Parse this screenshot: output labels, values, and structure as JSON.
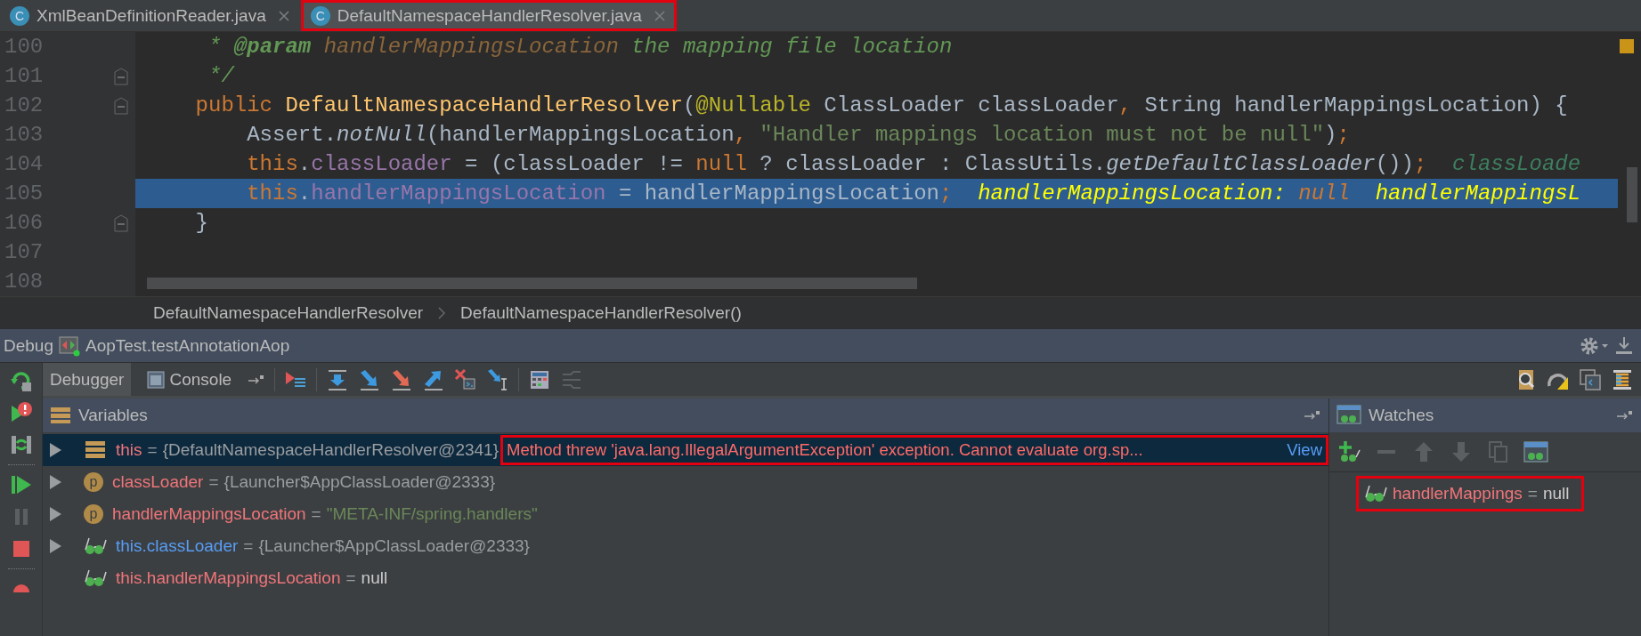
{
  "editor_tabs": [
    {
      "icon": "C",
      "label": "XmlBeanDefinitionReader.java",
      "selected": false,
      "annotated": false
    },
    {
      "icon": "C",
      "label": "DefaultNamespaceHandlerResolver.java",
      "selected": true,
      "annotated": true
    }
  ],
  "code_lines": [
    {
      "number": "100",
      "fold_marker": false,
      "highlighted": false,
      "tokens": [
        {
          "text": "     * ",
          "kind": "comment"
        },
        {
          "text": "@param",
          "kind": "tag"
        },
        {
          "text": " handlerMappingsLocation",
          "kind": "param"
        },
        {
          "text": " the mapping file location",
          "kind": "comment"
        }
      ]
    },
    {
      "number": "101",
      "fold_marker": true,
      "highlighted": false,
      "tokens": [
        {
          "text": "     */",
          "kind": "comment"
        }
      ]
    },
    {
      "number": "102",
      "fold_marker": true,
      "highlighted": false,
      "tokens": [
        {
          "text": "    public ",
          "kind": "kw"
        },
        {
          "text": "DefaultNamespaceHandlerResolver",
          "kind": "fn"
        },
        {
          "text": "(",
          "kind": "plain"
        },
        {
          "text": "@Nullable",
          "kind": "anno"
        },
        {
          "text": " ClassLoader classLoader",
          "kind": "plain"
        },
        {
          "text": ", ",
          "kind": "kw"
        },
        {
          "text": "String handlerMappingsLocation) {",
          "kind": "plain"
        }
      ]
    },
    {
      "number": "103",
      "fold_marker": false,
      "highlighted": false,
      "tokens": [
        {
          "text": "        Assert.",
          "kind": "plain"
        },
        {
          "text": "notNull",
          "kind": "static"
        },
        {
          "text": "(handlerMappingsLocation",
          "kind": "plain"
        },
        {
          "text": ", ",
          "kind": "kw"
        },
        {
          "text": "\"Handler mappings location must not be null\"",
          "kind": "string"
        },
        {
          "text": ")",
          "kind": "plain"
        },
        {
          "text": ";",
          "kind": "kw"
        }
      ]
    },
    {
      "number": "104",
      "fold_marker": false,
      "highlighted": false,
      "tokens": [
        {
          "text": "        this",
          "kind": "kw"
        },
        {
          "text": ".",
          "kind": "plain"
        },
        {
          "text": "classLoader",
          "kind": "field"
        },
        {
          "text": " = (classLoader != ",
          "kind": "plain"
        },
        {
          "text": "null",
          "kind": "kw"
        },
        {
          "text": " ? classLoader : ClassUtils.",
          "kind": "plain"
        },
        {
          "text": "getDefaultClassLoader",
          "kind": "static"
        },
        {
          "text": "())",
          "kind": "plain"
        },
        {
          "text": ";",
          "kind": "kw"
        },
        {
          "text": "  classLoade",
          "kind": "hint-dim"
        }
      ]
    },
    {
      "number": "105",
      "fold_marker": false,
      "highlighted": true,
      "tokens": [
        {
          "text": "        this",
          "kind": "kw"
        },
        {
          "text": ".",
          "kind": "plain"
        },
        {
          "text": "handlerMappingsLocation",
          "kind": "field"
        },
        {
          "text": " = handlerMappingsLocation",
          "kind": "plain"
        },
        {
          "text": ";",
          "kind": "kw"
        },
        {
          "text": "  handlerMappingsLocation: ",
          "kind": "hint"
        },
        {
          "text": "null",
          "kind": "hint-kw"
        },
        {
          "text": "  handlerMappingsL",
          "kind": "hint"
        }
      ]
    },
    {
      "number": "106",
      "fold_marker": true,
      "highlighted": false,
      "tokens": [
        {
          "text": "    }",
          "kind": "plain"
        }
      ]
    },
    {
      "number": "107",
      "fold_marker": false,
      "highlighted": false
    },
    {
      "number": "108",
      "fold_marker": false,
      "highlighted": false
    }
  ],
  "breadcrumbs": [
    "DefaultNamespaceHandlerResolver",
    "DefaultNamespaceHandlerResolver()"
  ],
  "debug": {
    "title": "Debug",
    "session": "AopTest.testAnnotationAop",
    "tabs": [
      {
        "label": "Debugger",
        "selected": true
      },
      {
        "label": "Console",
        "selected": false
      }
    ]
  },
  "variables": {
    "title": "Variables",
    "rows": [
      {
        "expandable": true,
        "selected": true,
        "kind": "object",
        "name": "this",
        "color": "#f0757a",
        "operator": "=",
        "value": {
          "text": "{DefaultNamespaceHandlerResolver@2341}",
          "color": "#9a9da0"
        },
        "error": {
          "text": "Method threw 'java.lang.IllegalArgumentException' exception. Cannot evaluate org.sp...",
          "link": "View",
          "annotated": true
        }
      },
      {
        "expandable": true,
        "selected": false,
        "kind": "param",
        "badge": "p",
        "name": "classLoader",
        "color": "#f0757a",
        "operator": "=",
        "value": {
          "text": "{Launcher$AppClassLoader@2333}",
          "color": "#9a9da0"
        }
      },
      {
        "expandable": true,
        "selected": false,
        "kind": "param",
        "badge": "p",
        "name": "handlerMappingsLocation",
        "color": "#f0757a",
        "operator": "=",
        "value": {
          "text": "\"META-INF/spring.handlers\"",
          "color": "#6a8759"
        }
      },
      {
        "expandable": true,
        "selected": false,
        "kind": "watch",
        "name": "this.classLoader",
        "color": "#589df6",
        "operator": "=",
        "value": {
          "text": "{Launcher$AppClassLoader@2333}",
          "color": "#9a9da0"
        }
      },
      {
        "expandable": false,
        "selected": false,
        "kind": "watch",
        "name": "this.handlerMappingsLocation",
        "color": "#f0757a",
        "operator": "=",
        "value": {
          "text": "null",
          "color": "#cccccc"
        }
      }
    ]
  },
  "watches": {
    "title": "Watches",
    "items": [
      {
        "name": "handlerMappings",
        "operator": "=",
        "value": "null",
        "annotated": true
      }
    ]
  }
}
